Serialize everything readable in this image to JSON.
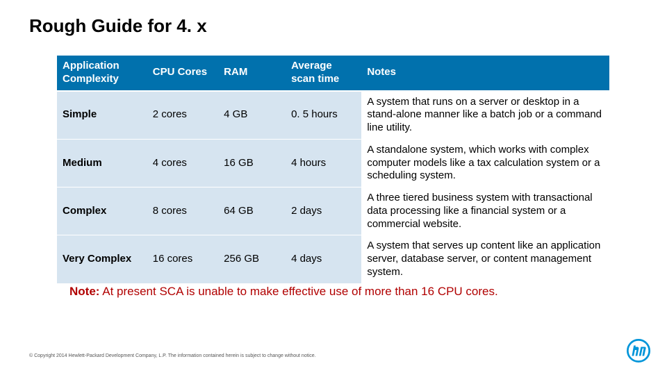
{
  "title": "Rough Guide for 4. x",
  "headers": {
    "complexity": "Application Complexity",
    "cores": "CPU Cores",
    "ram": "RAM",
    "scan": "Average scan time",
    "notes": "Notes"
  },
  "chart_data": {
    "type": "table",
    "columns": [
      "Application Complexity",
      "CPU Cores",
      "RAM",
      "Average scan time",
      "Notes"
    ],
    "rows": [
      {
        "complexity": "Simple",
        "cores": "2 cores",
        "ram": "4 GB",
        "scan": "0. 5 hours",
        "notes": "A system that runs on a server or desktop in a stand-alone manner like a batch job or a command line utility."
      },
      {
        "complexity": "Medium",
        "cores": "4 cores",
        "ram": "16 GB",
        "scan": "4 hours",
        "notes": "A standalone system, which works with complex computer models like a tax calculation system or a scheduling system."
      },
      {
        "complexity": "Complex",
        "cores": "8 cores",
        "ram": "64 GB",
        "scan": "2 days",
        "notes": "A three tiered business system with transactional data processing like a financial system or a commercial website."
      },
      {
        "complexity": "Very Complex",
        "cores": "16 cores",
        "ram": "256 GB",
        "scan": "4 days",
        "notes": "A system that serves up content like an application server, database server, or content management system."
      }
    ]
  },
  "note_prefix": "Note:",
  "note_body": " At present SCA is unable to make effective use of more than 16 CPU cores.",
  "copyright": "© Copyright 2014 Hewlett-Packard Development Company, L.P.  The information contained herein is subject to change without notice."
}
